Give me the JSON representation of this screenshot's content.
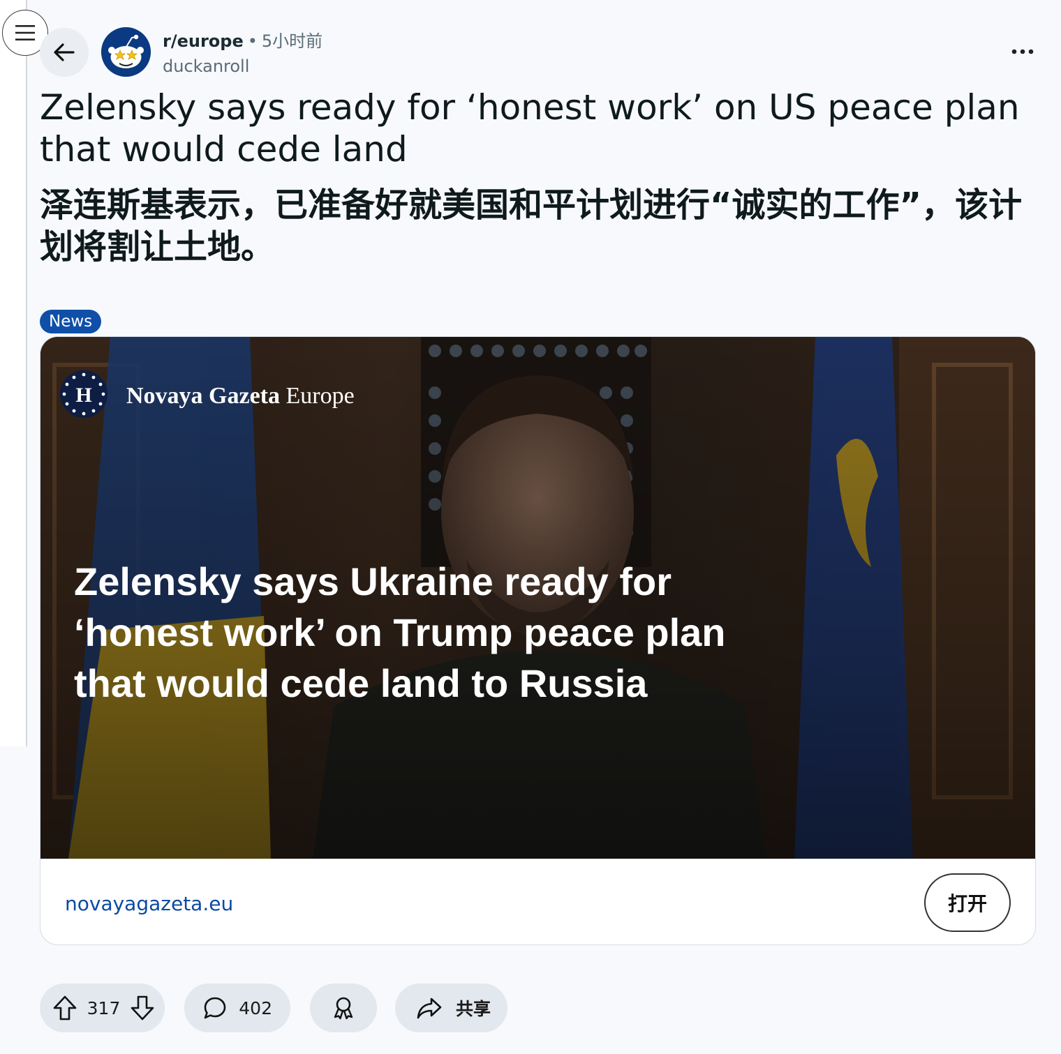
{
  "post": {
    "subreddit": "r/europe",
    "separator": "•",
    "time": "5小时前",
    "author": "duckanroll",
    "title_en": "Zelensky says ready for ‘honest work’ on US peace plan that would cede land",
    "title_zh": "泽连斯基表示，已准备好就美国和平计划进行“诚实的工作”，该计划将割让土地。",
    "flair": "News"
  },
  "link_card": {
    "image": {
      "logo_letter": "H",
      "brand_name": "Novaya Gazeta",
      "brand_region": "Europe",
      "headline_lines": [
        "Zelensky says Ukraine ready for",
        "‘honest work’ on Trump peace plan",
        "that would cede land to Russia"
      ]
    },
    "domain": "novayagazeta.eu",
    "open_label": "打开"
  },
  "actions": {
    "score": "317",
    "comments": "402",
    "share_label": "共享"
  },
  "icons": {
    "menu": "hamburger-menu-icon",
    "back": "arrow-left-icon",
    "more": "more-horizontal-icon",
    "upvote": "arrow-up-icon",
    "downvote": "arrow-down-icon",
    "comment": "speech-bubble-icon",
    "award": "award-ribbon-icon",
    "share": "share-arrow-icon"
  },
  "colors": {
    "flair_bg": "#0f4fa8",
    "link": "#0b4aa2",
    "pill_bg": "#e3e8ee",
    "avatar_bg": "#0b3a82"
  }
}
